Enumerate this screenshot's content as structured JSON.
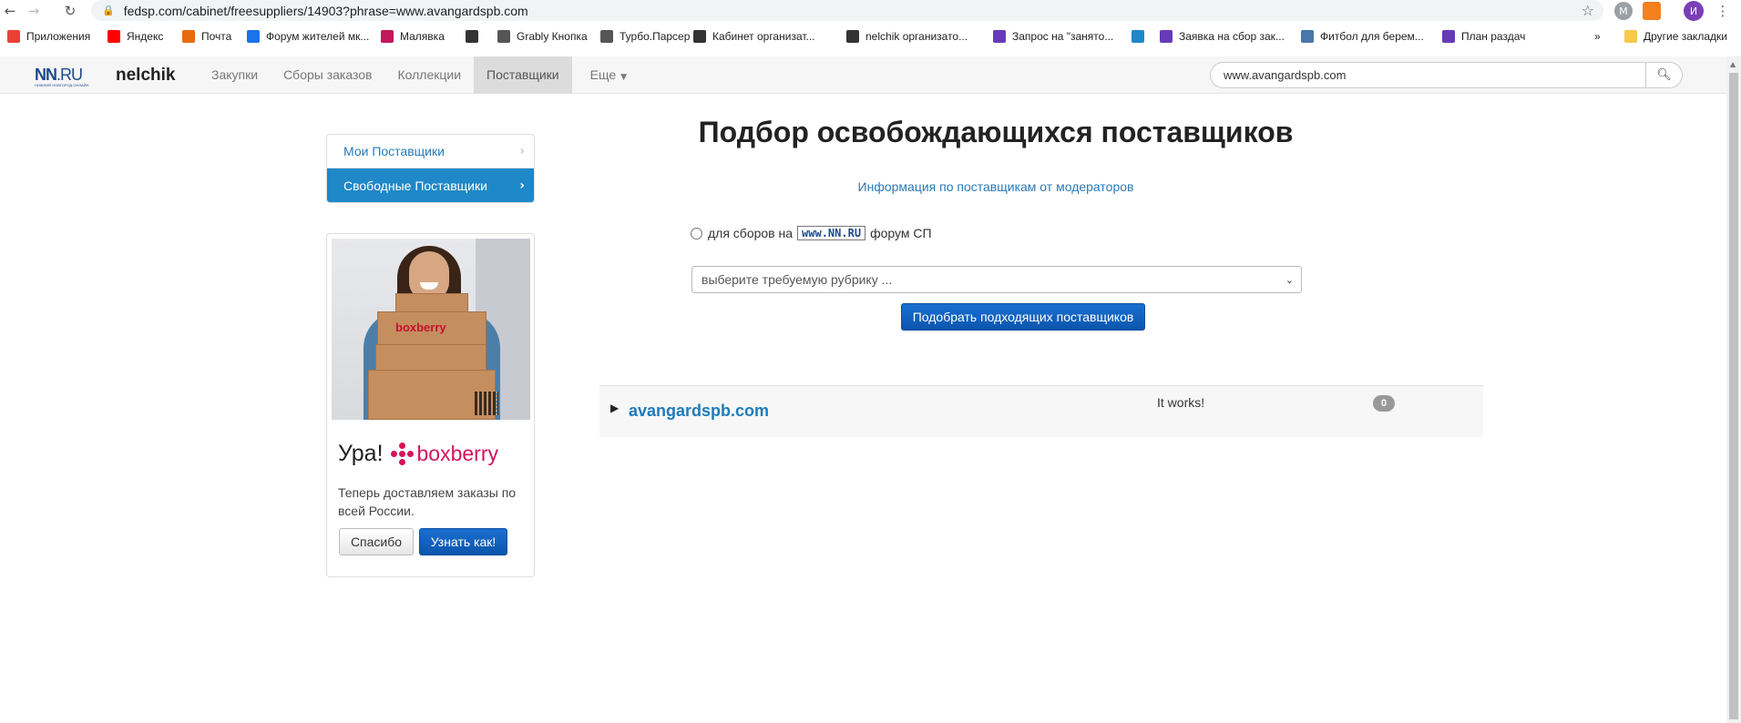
{
  "browser": {
    "url": "fedsp.com/cabinet/freesuppliers/14903?phrase=www.avangardspb.com",
    "profile_initial": "И",
    "ext_initial": "M"
  },
  "bookmarks": {
    "items": [
      {
        "label": "Приложения",
        "icon": "apps-icon",
        "color": "#e94235"
      },
      {
        "label": "Яндекс",
        "icon": "yandex-icon",
        "color": "#ff0000"
      },
      {
        "label": "Почта",
        "icon": "mail-icon",
        "color": "#e86a10"
      },
      {
        "label": "Форум жителей мк...",
        "icon": "forum-icon",
        "color": "#1a73e8"
      },
      {
        "label": "Малявка",
        "icon": "malyavka-icon",
        "color": "#c2185b"
      },
      {
        "label": "",
        "icon": "nn-sheep-icon",
        "color": "#333333"
      },
      {
        "label": "Grably Кнопка",
        "icon": "globe-icon",
        "color": "#555555"
      },
      {
        "label": "Турбо.Парсер",
        "icon": "globe-icon",
        "color": "#555555"
      },
      {
        "label": "Кабинет организат...",
        "icon": "nn-sheep-icon",
        "color": "#333333"
      },
      {
        "label": "nelchik организато...",
        "icon": "nn-sheep-icon",
        "color": "#333333"
      },
      {
        "label": "Запрос на \"занято...",
        "icon": "forms-icon",
        "color": "#673ab7"
      },
      {
        "label": "",
        "icon": "puzzle-icon",
        "color": "#1e88c8"
      },
      {
        "label": "Заявка на сбор зак...",
        "icon": "forms-icon",
        "color": "#673ab7"
      },
      {
        "label": "Фитбол для берем...",
        "icon": "vk-icon",
        "color": "#4a76a8"
      },
      {
        "label": "План раздач",
        "icon": "forms-icon",
        "color": "#673ab7"
      }
    ],
    "more": "»",
    "other": "Другие закладки"
  },
  "site": {
    "logo_main": "NN",
    "logo_ru": ".RU",
    "logo_sub": "НИЖНИЙ НОВГОРОД ОНЛАЙН",
    "username": "nelchik",
    "tabs": [
      {
        "label": "Закупки",
        "active": false
      },
      {
        "label": "Сборы заказов",
        "active": false
      },
      {
        "label": "Коллекции",
        "active": false
      },
      {
        "label": "Поставщики",
        "active": true
      },
      {
        "label": "Еще",
        "active": false
      }
    ],
    "search_value": "www.avangardspb.com"
  },
  "sidemenu": {
    "items": [
      {
        "label": "Мои Поставщики",
        "active": false
      },
      {
        "label": "Свободные Поставщики",
        "active": true
      }
    ]
  },
  "ad": {
    "image_brand": "boxberry",
    "title": "Ура!",
    "brand": "boxberry",
    "text": "Теперь доставляем заказы по всей России.",
    "btn_thanks": "Спасибо",
    "btn_learn": "Узнать как!"
  },
  "main": {
    "title": "Подбор освобождающихся поставщиков",
    "info_link": "Информация по поставщикам от модераторов",
    "radio_prefix": "для сборов на",
    "radio_badge": "www.NN.RU",
    "radio_suffix": "форум СП",
    "select_placeholder": "выберите требуемую рубрику ...",
    "submit": "Подобрать подходящих поставщиков"
  },
  "result": {
    "domain": "avangardspb.com",
    "status": "It works!",
    "count": "0"
  },
  "colors": {
    "accent": "#1e88c8",
    "primary_button": "#0b55ad",
    "link": "#2a7ab8",
    "boxberry": "#d5135a"
  }
}
